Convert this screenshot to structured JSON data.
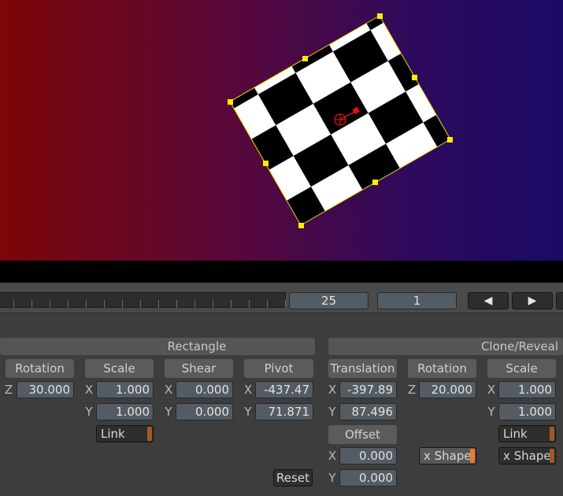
{
  "timeline": {
    "frame_value": "25",
    "step_value": "1",
    "prev_icon": "left-triangle-icon",
    "next_icon": "right-triangle-icon"
  },
  "rectangle": {
    "section_label": "Rectangle",
    "rotation": {
      "label": "Rotation",
      "axis_z": "Z",
      "z": "30.000"
    },
    "scale": {
      "label": "Scale",
      "axis_x": "X",
      "axis_y": "Y",
      "x": "1.000",
      "y": "1.000",
      "link_label": "Link"
    },
    "shear": {
      "label": "Shear",
      "axis_x": "X",
      "axis_y": "Y",
      "x": "0.000",
      "y": "0.000"
    },
    "pivot": {
      "label": "Pivot",
      "axis_x": "X",
      "axis_y": "Y",
      "x": "-437.47",
      "y": "71.871"
    },
    "reset_label": "Reset"
  },
  "clone": {
    "section_label": "Clone/Reveal",
    "translation": {
      "label": "Translation",
      "axis_x": "X",
      "axis_y": "Y",
      "x": "-397.89",
      "y": "87.496"
    },
    "offset": {
      "label": "Offset",
      "axis_x": "X",
      "axis_y": "Y",
      "x": "0.000",
      "y": "0.000"
    },
    "rotation": {
      "label": "Rotation",
      "axis_z": "Z",
      "z": "20.000",
      "shape_label": "x Shape"
    },
    "scale": {
      "label": "Scale",
      "axis_x": "X",
      "axis_y": "Y",
      "x": "1.000",
      "y": "1.000",
      "link_label": "Link",
      "shape_label": "x Shape"
    }
  },
  "colors": {
    "handle": "#ffee00",
    "pivot": "#e01010",
    "outline": "#e8d800"
  }
}
